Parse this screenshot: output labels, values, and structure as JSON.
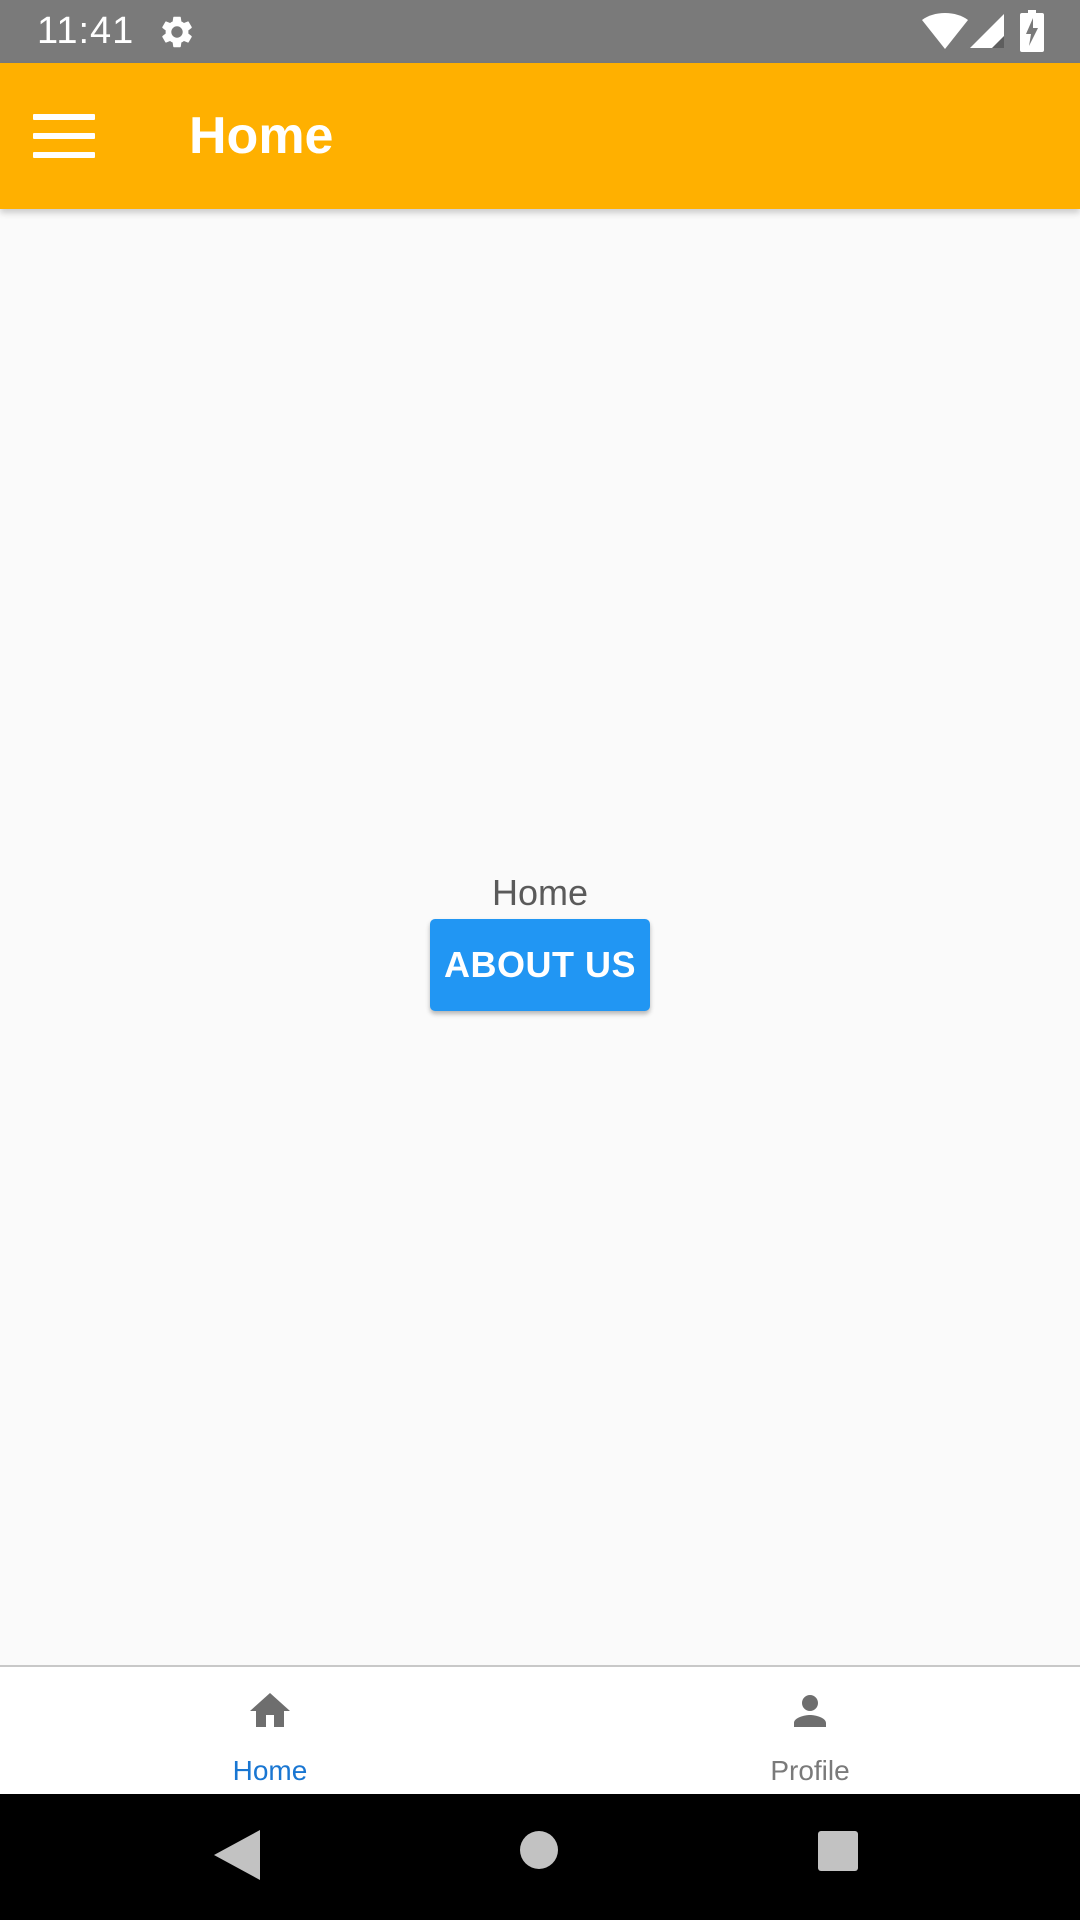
{
  "status_bar": {
    "time": "11:41",
    "icons": [
      "gear-icon",
      "wifi-icon",
      "signal-icon",
      "battery-charging-icon"
    ]
  },
  "app_bar": {
    "title": "Home",
    "menu_icon": "hamburger-menu-icon",
    "background_color": "#ffb000"
  },
  "content": {
    "screen_label": "Home",
    "about_button_label": "ABOUT US",
    "button_color": "#2196f3"
  },
  "tabs": [
    {
      "label": "Home",
      "icon": "home-icon",
      "active": true,
      "color": "#1976d2"
    },
    {
      "label": "Profile",
      "icon": "person-icon",
      "active": false,
      "color": "#7a7a7a"
    }
  ],
  "nav_bar": {
    "icons": [
      "back-triangle-icon",
      "home-circle-icon",
      "recents-square-icon"
    ]
  }
}
